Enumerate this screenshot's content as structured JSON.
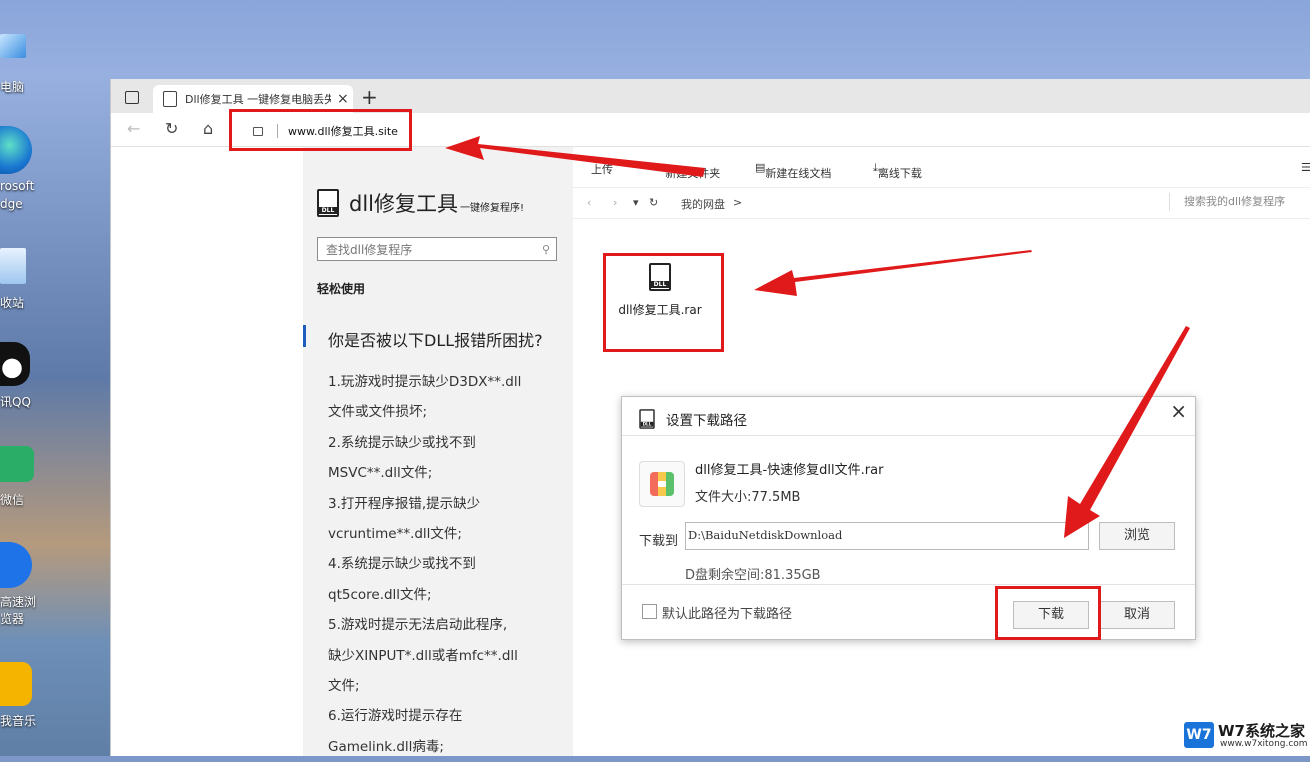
{
  "desktop": {
    "icons": [
      {
        "label": "电脑"
      },
      {
        "label": "rosoft"
      },
      {
        "label": "dge"
      },
      {
        "label": "收站"
      },
      {
        "label": "讯QQ"
      },
      {
        "label": "微信"
      },
      {
        "label": "高速浏"
      },
      {
        "label": "览器"
      },
      {
        "label": "我音乐"
      }
    ]
  },
  "browser": {
    "tab_title": "Dll修复工具 一键修复电脑丢失DLL",
    "tab_close": "×",
    "new_tab": "+",
    "back": "←",
    "refresh": "↻",
    "home": "⌂",
    "address": "www.dll修复工具.site"
  },
  "sidebar": {
    "logo_title": "dll修复工具",
    "logo_subtitle": "一键修复程序!",
    "search_placeholder": "查找dll修复程序",
    "easy_use": "轻松使用",
    "question": "你是否被以下DLL报错所困扰?",
    "issues": [
      "1.玩游戏时提示缺少D3DX**.dll",
      "文件或文件损坏;",
      "2.系统提示缺少或找不到",
      "MSVC**.dll文件;",
      "3.打开程序报错,提示缺少",
      "vcruntime**.dll文件;",
      "4.系统提示缺少或找不到",
      "qt5core.dll文件;",
      "5.游戏时提示无法启动此程序,",
      "缺少XINPUT*.dll或者mfc**.dll",
      "文件;",
      "6.运行游戏时提示存在",
      "Gamelink.dll病毒;"
    ]
  },
  "netdisk": {
    "toolbar": {
      "upload": "上传",
      "new_folder": "新建文件夹",
      "new_online_doc": "新建在线文档",
      "offline_download": "离线下载"
    },
    "path_root": "我的网盘",
    "path_sep": ">",
    "search_placeholder": "搜索我的dll修复程序",
    "file_name": "dll修复工具.rar"
  },
  "dialog": {
    "title": "设置下载路径",
    "close": "×",
    "file_name": "dll修复工具-快速修复dll文件.rar",
    "file_size": "文件大小:77.5MB",
    "download_to_label": "下载到",
    "path_value": "D:\\BaiduNetdiskDownload",
    "browse": "浏览",
    "free_space": "D盘剩余空间:81.35GB",
    "default_path_label": "默认此路径为下载路径",
    "download_button": "下载",
    "cancel_button": "取消"
  },
  "watermark": {
    "logo": "W7",
    "title": "W7系统之家",
    "url": "www.w7xitong.com"
  },
  "colors": {
    "highlight_red": "#e01a1a",
    "accent_blue": "#1f5bbf"
  }
}
